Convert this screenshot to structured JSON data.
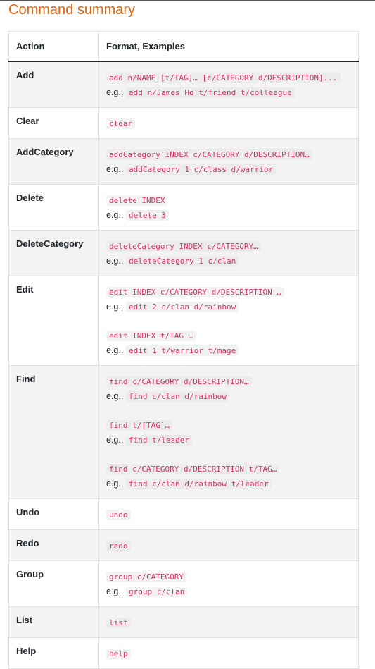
{
  "heading": "Command summary",
  "table": {
    "headers": [
      "Action",
      "Format, Examples"
    ],
    "rows": [
      {
        "action": "Add",
        "groups": [
          {
            "format": "add n/NAME [t/TAG]… [c/CATEGORY d/DESCRIPTION]...",
            "example_prefix": "e.g.,",
            "example": "add n/James Ho t/friend t/colleague"
          }
        ]
      },
      {
        "action": "Clear",
        "groups": [
          {
            "format": "clear"
          }
        ]
      },
      {
        "action": "AddCategory",
        "groups": [
          {
            "format": "addCategory INDEX c/CATEGORY d/DESCRIPTION…",
            "example_prefix": "e.g.,",
            "example": "addCategory 1 c/class d/warrior"
          }
        ]
      },
      {
        "action": "Delete",
        "groups": [
          {
            "format": "delete INDEX",
            "example_prefix": "e.g.,",
            "example": "delete 3"
          }
        ]
      },
      {
        "action": "DeleteCategory",
        "groups": [
          {
            "format": "deleteCategory INDEX c/CATEGORY…",
            "example_prefix": "e.g.,",
            "example": "deleteCategory 1 c/clan"
          }
        ]
      },
      {
        "action": "Edit",
        "groups": [
          {
            "format": "edit INDEX c/CATEGORY d/DESCRIPTION …",
            "example_prefix": "e.g.,",
            "example": "edit 2 c/clan d/rainbow"
          },
          {
            "format": "edit INDEX t/TAG …",
            "example_prefix": "e.g.,",
            "example": "edit 1 t/warrior t/mage"
          }
        ]
      },
      {
        "action": "Find",
        "groups": [
          {
            "format": "find c/CATEGORY d/DESCRIPTION…",
            "example_prefix": "e.g.,",
            "example": "find c/clan d/rainbow"
          },
          {
            "format": "find t/[TAG]…",
            "example_prefix": "e.g.,",
            "example": "find t/leader"
          },
          {
            "format": "find c/CATEGORY d/DESCRIPTION t/TAG…",
            "example_prefix": "e.g.,",
            "example": "find c/clan d/rainbow t/leader"
          }
        ]
      },
      {
        "action": "Undo",
        "groups": [
          {
            "format": "undo"
          }
        ]
      },
      {
        "action": "Redo",
        "groups": [
          {
            "format": "redo"
          }
        ]
      },
      {
        "action": "Group",
        "groups": [
          {
            "format": "group c/CATEGORY",
            "example_prefix": "e.g.,",
            "example": "group c/clan"
          }
        ]
      },
      {
        "action": "List",
        "groups": [
          {
            "format": "list"
          }
        ]
      },
      {
        "action": "Help",
        "groups": [
          {
            "format": "help"
          }
        ]
      }
    ]
  }
}
